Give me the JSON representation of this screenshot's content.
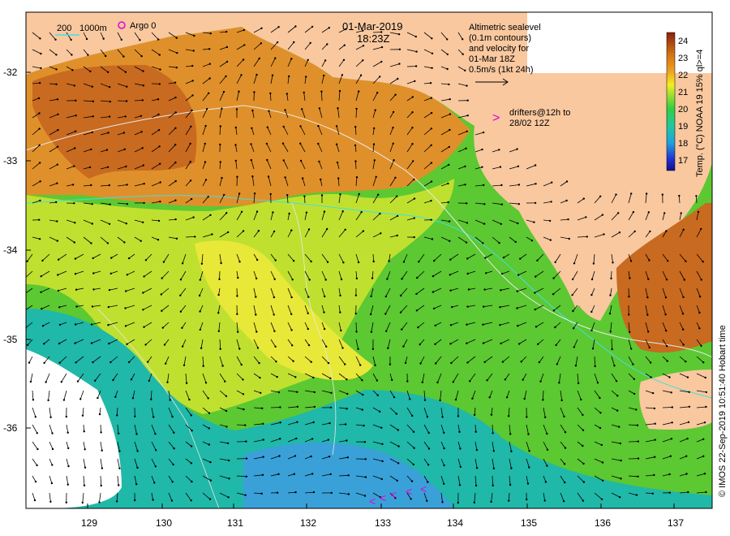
{
  "map": {
    "date": "01-Mar-2019",
    "time": "18:23Z",
    "isobath_legend": {
      "shallow": "200",
      "deep": "1000m"
    },
    "argo_legend": "Argo 0",
    "altimetry_note": [
      "Altimetric sealevel",
      "(0.1m contours)",
      "and velocity for",
      "01-Mar 18Z",
      "0.5m/s (1kt 24h)"
    ],
    "drifters_note": [
      "drifters@12h to",
      "28/02 12Z"
    ],
    "drifter_marker": ">",
    "colorbar": {
      "label": "Temp. (°C) NOAA 19 15% ql>=4",
      "ticks": [
        "24",
        "23",
        "22",
        "21",
        "20",
        "19",
        "18",
        "17"
      ],
      "min": 16.5,
      "max": 24.5
    },
    "credit": "© IMOS 22-Sep-2019 10:51:40 Hobart time",
    "lat_ticks": [
      "-32",
      "-33",
      "-34",
      "-35",
      "-36"
    ],
    "lon_ticks": [
      "129",
      "130",
      "131",
      "132",
      "133",
      "134",
      "135",
      "136",
      "137"
    ],
    "lat_values": [
      -32,
      -33,
      -34,
      -35,
      -36
    ],
    "lon_values": [
      129,
      130,
      131,
      132,
      133,
      134,
      135,
      136,
      137
    ],
    "lat_range": [
      -36.9,
      -31.3
    ],
    "lon_range": [
      128.2,
      137.5
    ]
  },
  "colors": {
    "land": "#f9c89f",
    "argo": "#e000e0",
    "drifter": "#e000e0",
    "isobath_200": "#40e0e0",
    "isobath_1000": "#e8e8e8"
  }
}
